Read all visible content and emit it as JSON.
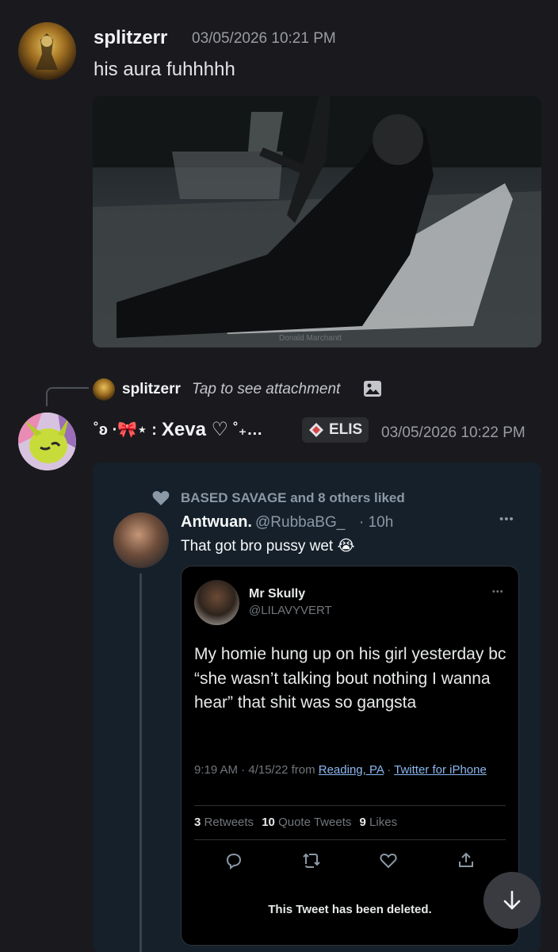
{
  "message1": {
    "username": "splitzerr",
    "timestamp": "03/05/2026 10:21 PM",
    "text": "his aura fuhhhhh",
    "image_icon": "photo-attachment",
    "watermark": "Donald Marchantt"
  },
  "reply": {
    "username": "splitzerr",
    "text": "Tap to see attachment",
    "icon": "image-icon"
  },
  "message2": {
    "username_prefix": "˚ʚ ·🎀⋆ :",
    "username_name": "Xeva ♡",
    "username_suffix": "˚₊…",
    "tag_icon": "diamond-icon",
    "tag_label": "ELIS",
    "timestamp": "03/05/2026 10:22 PM"
  },
  "tweet": {
    "liked_by": "BASED SAVAGE and 8 others liked",
    "author_name": "Antwuan.",
    "author_handle": "@RubbaBG_",
    "time": "· 10h",
    "text": "That got bro pussy wet",
    "emoji": "😭",
    "menu": "•••"
  },
  "quoted": {
    "author_name": "Mr Skully",
    "author_handle": "@LILAVYVERT",
    "menu": "•••",
    "text": "My homie hung up on his girl yesterday bc “she wasn’t talking bout nothing I wanna hear” that shit was so gangsta",
    "meta_time": "9:19 AM · 4/15/22 from",
    "meta_location": "Reading, PA",
    "meta_sep": "·",
    "meta_source": "Twitter for iPhone",
    "retweets_count": "3",
    "retweets_label": "Retweets",
    "quotes_count": "10",
    "quotes_label": "Quote Tweets",
    "likes_count": "9",
    "likes_label": "Likes",
    "deleted_notice": "This Tweet has been deleted."
  },
  "colors": {
    "background": "#1a1a1e",
    "link": "#8bb8f0",
    "tweet_bg": "#15202b"
  }
}
